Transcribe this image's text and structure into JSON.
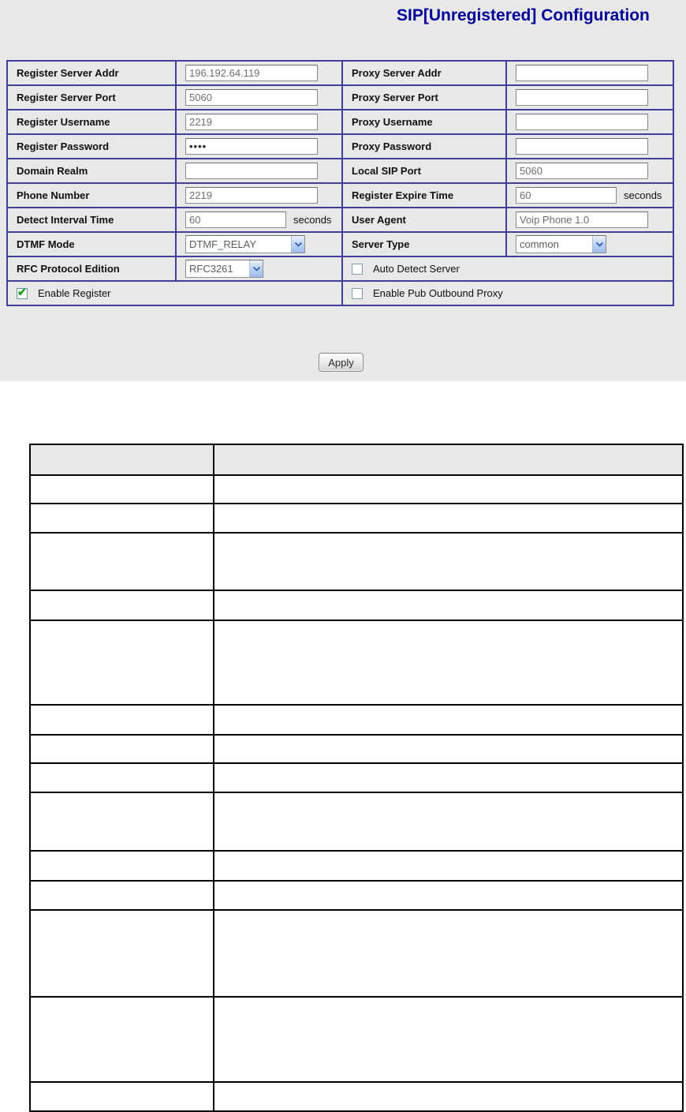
{
  "page": {
    "title": "SIP[Unregistered] Configuration"
  },
  "form": {
    "rows": [
      {
        "left_label": "Register Server Addr",
        "left_value": "196.192.64.119",
        "right_label": "Proxy Server Addr",
        "right_value": ""
      },
      {
        "left_label": "Register Server Port",
        "left_value": "5060",
        "right_label": "Proxy Server Port",
        "right_value": ""
      },
      {
        "left_label": "Register Username",
        "left_value": "2219",
        "right_label": "Proxy Username",
        "right_value": ""
      },
      {
        "left_label": "Register Password",
        "left_value": "••••",
        "right_label": "Proxy Password",
        "right_value": ""
      },
      {
        "left_label": "Domain Realm",
        "left_value": "",
        "right_label": "Local SIP Port",
        "right_value": "5060"
      },
      {
        "left_label": "Phone Number",
        "left_value": "2219",
        "right_label": "Register Expire Time",
        "right_value": "60",
        "right_suffix": "seconds"
      },
      {
        "left_label": "Detect Interval Time",
        "left_value": "60",
        "left_suffix": "seconds",
        "right_label": "User Agent",
        "right_value": "Voip Phone 1.0"
      },
      {
        "left_label": "DTMF Mode",
        "left_select": "DTMF_RELAY",
        "right_label": "Server Type",
        "right_select": "common"
      },
      {
        "left_label": "RFC Protocol Edition",
        "left_select": "RFC3261",
        "right_checkbox": {
          "label": "Auto Detect Server",
          "checked": false
        }
      },
      {
        "left_checkbox": {
          "label": "Enable Register",
          "checked": true
        },
        "right_checkbox": {
          "label": "Enable Pub Outbound Proxy",
          "checked": false
        }
      }
    ],
    "apply_label": "Apply"
  },
  "bottom_table": {
    "header": [
      "",
      ""
    ],
    "rows": [
      [
        "",
        ""
      ],
      [
        "",
        ""
      ],
      [
        "",
        ""
      ],
      [
        "",
        ""
      ],
      [
        "",
        ""
      ],
      [
        "",
        ""
      ],
      [
        "",
        ""
      ],
      [
        "",
        ""
      ],
      [
        "",
        ""
      ],
      [
        "",
        ""
      ],
      [
        "",
        ""
      ],
      [
        "",
        ""
      ],
      [
        "",
        ""
      ],
      [
        "",
        ""
      ]
    ]
  },
  "colors": {
    "panel_bg": "#e8e8e8",
    "form_border": "#40409a",
    "title_text": "#000099",
    "doc_border": "#000000",
    "check_green": "#17a017"
  }
}
